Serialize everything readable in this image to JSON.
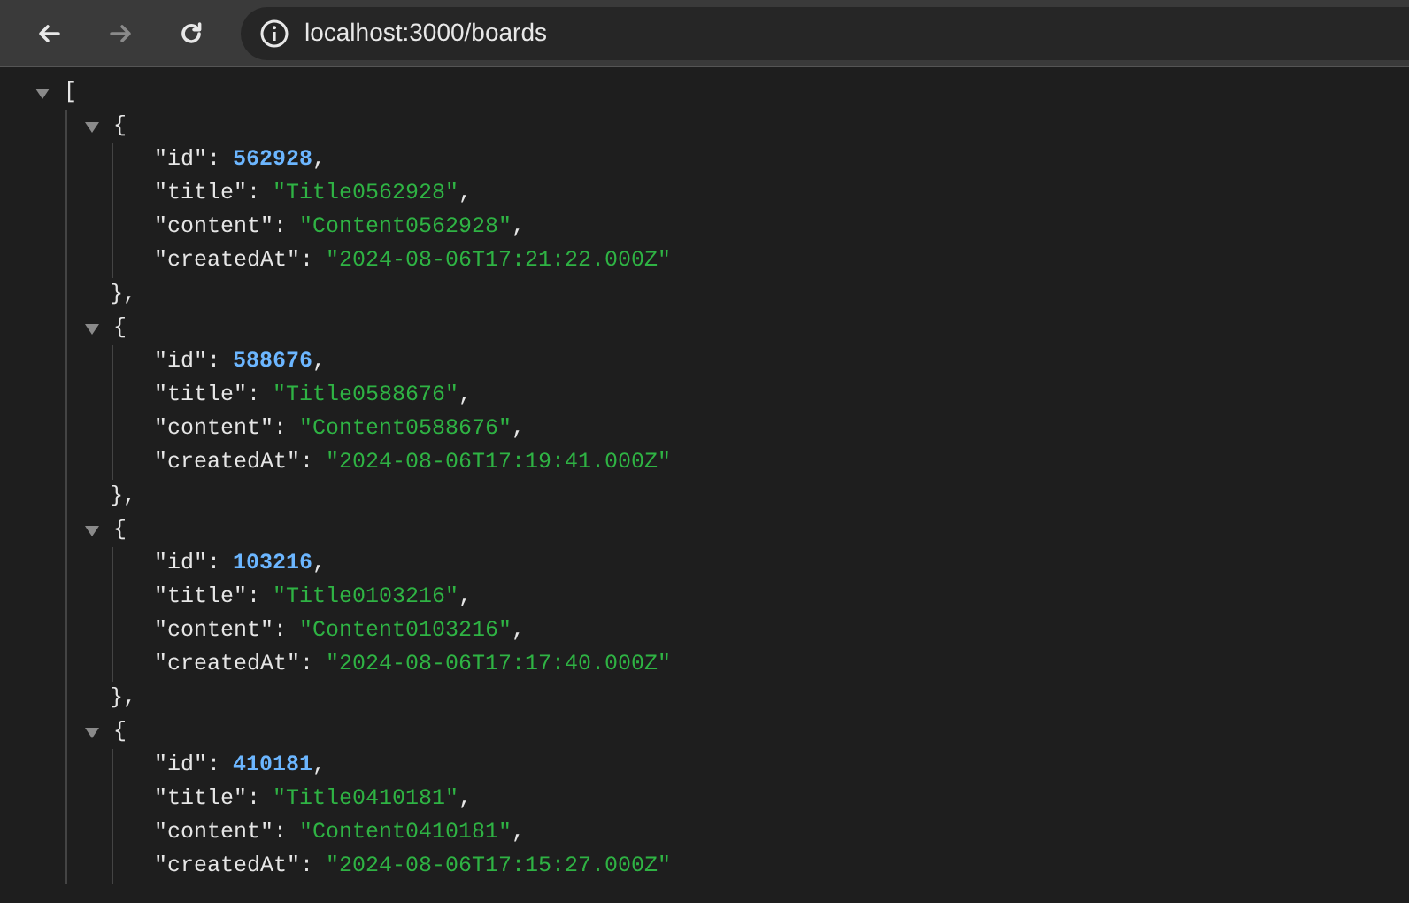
{
  "toolbar": {
    "buttons": [
      {
        "kind": "back",
        "disabled": false
      },
      {
        "kind": "forward",
        "disabled": true
      },
      {
        "kind": "reload",
        "disabled": false
      }
    ],
    "url": "localhost:3000/boards"
  },
  "json_view": {
    "open": "[",
    "expanded": true,
    "items": [
      {
        "open": "{",
        "expanded": true,
        "close": "},",
        "fields": [
          {
            "key": "\"id\":",
            "value": "562928",
            "kind": "number",
            "comma": ","
          },
          {
            "key": "\"title\":",
            "value": "\"Title0562928\"",
            "kind": "string",
            "comma": ","
          },
          {
            "key": "\"content\":",
            "value": "\"Content0562928\"",
            "kind": "string",
            "comma": ","
          },
          {
            "key": "\"createdAt\":",
            "value": "\"2024-08-06T17:21:22.000Z\"",
            "kind": "string"
          }
        ]
      },
      {
        "open": "{",
        "expanded": true,
        "close": "},",
        "fields": [
          {
            "key": "\"id\":",
            "value": "588676",
            "kind": "number",
            "comma": ","
          },
          {
            "key": "\"title\":",
            "value": "\"Title0588676\"",
            "kind": "string",
            "comma": ","
          },
          {
            "key": "\"content\":",
            "value": "\"Content0588676\"",
            "kind": "string",
            "comma": ","
          },
          {
            "key": "\"createdAt\":",
            "value": "\"2024-08-06T17:19:41.000Z\"",
            "kind": "string"
          }
        ]
      },
      {
        "open": "{",
        "expanded": true,
        "close": "},",
        "fields": [
          {
            "key": "\"id\":",
            "value": "103216",
            "kind": "number",
            "comma": ","
          },
          {
            "key": "\"title\":",
            "value": "\"Title0103216\"",
            "kind": "string",
            "comma": ","
          },
          {
            "key": "\"content\":",
            "value": "\"Content0103216\"",
            "kind": "string",
            "comma": ","
          },
          {
            "key": "\"createdAt\":",
            "value": "\"2024-08-06T17:17:40.000Z\"",
            "kind": "string"
          }
        ]
      },
      {
        "open": "{",
        "expanded": true,
        "fields": [
          {
            "key": "\"id\":",
            "value": "410181",
            "kind": "number",
            "comma": ","
          },
          {
            "key": "\"title\":",
            "value": "\"Title0410181\"",
            "kind": "string",
            "comma": ","
          },
          {
            "key": "\"content\":",
            "value": "\"Content0410181\"",
            "kind": "string",
            "comma": ","
          },
          {
            "key": "\"createdAt\":",
            "value": "\"2024-08-06T17:15:27.000Z\"",
            "kind": "string"
          }
        ]
      }
    ]
  }
}
